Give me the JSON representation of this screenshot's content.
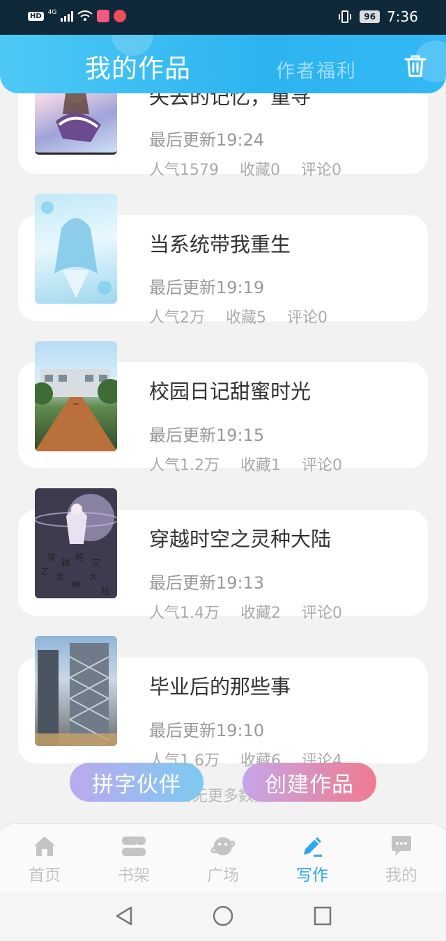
{
  "status_bar": {
    "network": "4G",
    "time": "7:36",
    "battery": "96"
  },
  "header": {
    "title": "我的作品",
    "tab": "作者福利",
    "delete_icon": "trash-icon",
    "gradient": [
      "#4ec9f5",
      "#2cb3f0"
    ]
  },
  "works": [
    {
      "title": "失去的记忆，重寻",
      "updated": "最后更新19:24",
      "popularity": "人气1579",
      "favorites": "收藏0",
      "comments": "评论0"
    },
    {
      "title": "当系统带我重生",
      "updated": "最后更新19:19",
      "popularity": "人气2万",
      "favorites": "收藏5",
      "comments": "评论0"
    },
    {
      "title": "校园日记甜蜜时光",
      "updated": "最后更新19:15",
      "popularity": "人气1.2万",
      "favorites": "收藏1",
      "comments": "评论0"
    },
    {
      "title": "穿越时空之灵种大陆",
      "updated": "最后更新19:13",
      "popularity": "人气1.4万",
      "favorites": "收藏2",
      "comments": "评论0",
      "cover_text": [
        "穿",
        "越",
        "时",
        "空",
        "之",
        "灵",
        "种",
        "大",
        "陆"
      ]
    },
    {
      "title": "毕业后的那些事",
      "updated": "最后更新19:10",
      "popularity": "人气1.6万",
      "favorites": "收藏6",
      "comments": "评论4"
    }
  ],
  "no_more": "暂无更多数据",
  "buttons": {
    "partner": "拼字伙伴",
    "create": "创建作品"
  },
  "nav": [
    {
      "label": "首页",
      "icon": "home-icon"
    },
    {
      "label": "书架",
      "icon": "bookshelf-icon"
    },
    {
      "label": "广场",
      "icon": "planet-icon"
    },
    {
      "label": "写作",
      "icon": "pen-icon",
      "active": true
    },
    {
      "label": "我的",
      "icon": "chat-icon"
    }
  ],
  "colors": {
    "accent": "#2ea7e8",
    "page_bg": "#f2f2f2"
  }
}
